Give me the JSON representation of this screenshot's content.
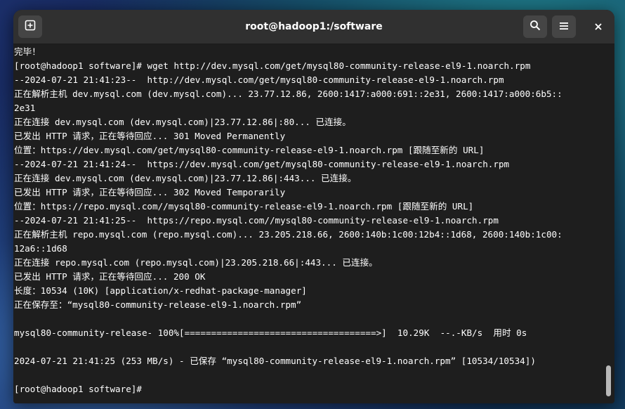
{
  "window": {
    "title": "root@hadoop1:/software"
  },
  "icons": {
    "new_tab": "new-tab-icon",
    "search": "search-icon",
    "menu": "hamburger-menu-icon",
    "close": "close-icon"
  },
  "terminal": {
    "lines": [
      "完毕！",
      "[root@hadoop1 software]# wget http://dev.mysql.com/get/mysql80-community-release-el9-1.noarch.rpm",
      "--2024-07-21 21:41:23--  http://dev.mysql.com/get/mysql80-community-release-el9-1.noarch.rpm",
      "正在解析主机 dev.mysql.com (dev.mysql.com)... 23.77.12.86, 2600:1417:a000:691::2e31, 2600:1417:a000:6b5::",
      "2e31",
      "正在连接 dev.mysql.com (dev.mysql.com)|23.77.12.86|:80... 已连接。",
      "已发出 HTTP 请求，正在等待回应... 301 Moved Permanently",
      "位置：https://dev.mysql.com/get/mysql80-community-release-el9-1.noarch.rpm [跟随至新的 URL]",
      "--2024-07-21 21:41:24--  https://dev.mysql.com/get/mysql80-community-release-el9-1.noarch.rpm",
      "正在连接 dev.mysql.com (dev.mysql.com)|23.77.12.86|:443... 已连接。",
      "已发出 HTTP 请求，正在等待回应... 302 Moved Temporarily",
      "位置：https://repo.mysql.com//mysql80-community-release-el9-1.noarch.rpm [跟随至新的 URL]",
      "--2024-07-21 21:41:25--  https://repo.mysql.com//mysql80-community-release-el9-1.noarch.rpm",
      "正在解析主机 repo.mysql.com (repo.mysql.com)... 23.205.218.66, 2600:140b:1c00:12b4::1d68, 2600:140b:1c00:",
      "12a6::1d68",
      "正在连接 repo.mysql.com (repo.mysql.com)|23.205.218.66|:443... 已连接。",
      "已发出 HTTP 请求，正在等待回应... 200 OK",
      "长度：10534 (10K) [application/x-redhat-package-manager]",
      "正在保存至：“mysql80-community-release-el9-1.noarch.rpm”",
      "",
      "mysql80-community-release- 100%[====================================>]  10.29K  --.-KB/s  用时 0s",
      "",
      "2024-07-21 21:41:25 (253 MB/s) - 已保存 “mysql80-community-release-el9-1.noarch.rpm” [10534/10534])",
      "",
      "[root@hadoop1 software]# "
    ]
  },
  "colors": {
    "terminal_bg": "#1e1e1e",
    "titlebar_bg": "#303030",
    "text": "#ffffff"
  }
}
